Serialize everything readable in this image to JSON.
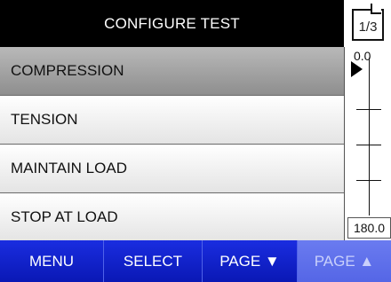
{
  "header": {
    "title": "CONFIGURE TEST",
    "page_indicator": "1/3"
  },
  "menu": {
    "items": [
      {
        "label": "COMPRESSION",
        "selected": true
      },
      {
        "label": "TENSION",
        "selected": false
      },
      {
        "label": "MAINTAIN LOAD",
        "selected": false
      },
      {
        "label": "STOP AT LOAD",
        "selected": false
      }
    ]
  },
  "scale": {
    "top_value": "0.0",
    "bottom_value": "180.0"
  },
  "buttons": {
    "menu": "MENU",
    "select": "SELECT",
    "page_down": "PAGE ▼",
    "page_up": "PAGE ▲"
  },
  "colors": {
    "header_bg": "#000000",
    "button_blue": "#1a2de0",
    "button_disabled": "#6a7bf0",
    "selected_item": "#a0a0a0"
  }
}
